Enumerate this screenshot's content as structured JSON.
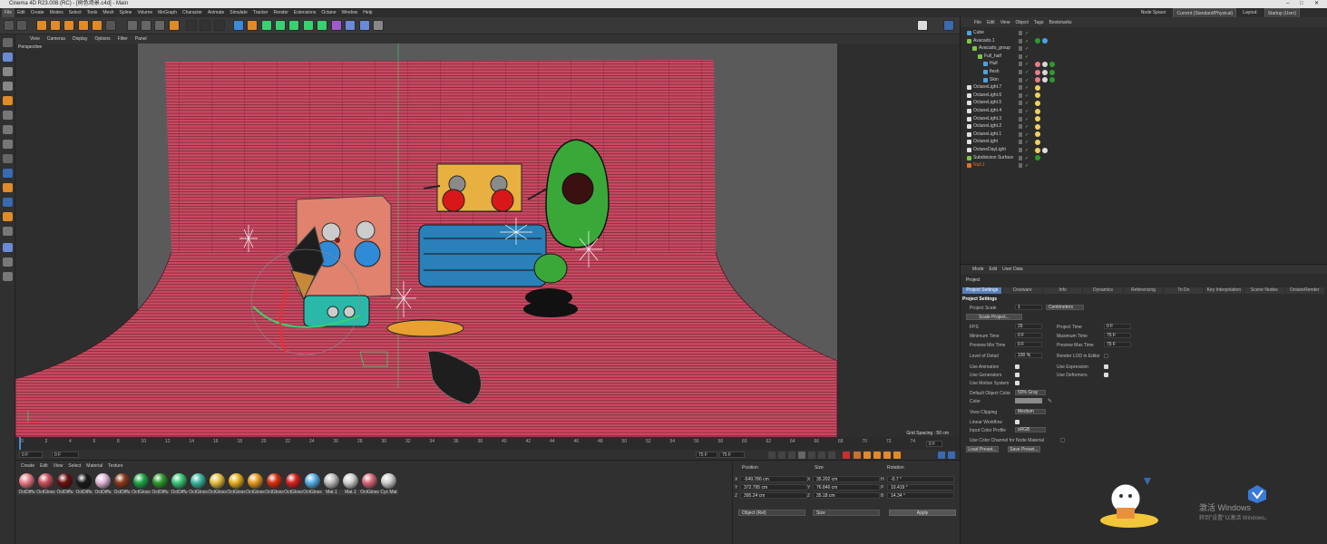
{
  "window": {
    "title": "Cinema 4D R23.008 (RC) - [树色场景.c4d] - Main"
  },
  "menubar": {
    "items": [
      "File",
      "Edit",
      "Create",
      "Modes",
      "Select",
      "Tools",
      "Mesh",
      "Spline",
      "Volume",
      "MoGraph",
      "Character",
      "Animate",
      "Simulate",
      "Tracker",
      "Render",
      "Extensions",
      "Octane",
      "Window",
      "Help"
    ],
    "node_space_label": "Node Space:",
    "node_space_value": "Current (Standard/Physical)",
    "layout_label": "Layout:",
    "layout_value": "Startup (User)"
  },
  "viewport": {
    "menu": [
      "View",
      "Cameras",
      "Display",
      "Options",
      "Filter",
      "Panel"
    ],
    "camera": "Perspective",
    "grid_spacing": "Grid Spacing : 50 cm"
  },
  "timeline": {
    "ticks": [
      "0",
      "2",
      "4",
      "6",
      "8",
      "10",
      "12",
      "14",
      "16",
      "18",
      "20",
      "22",
      "24",
      "26",
      "28",
      "30",
      "32",
      "34",
      "36",
      "38",
      "40",
      "42",
      "44",
      "46",
      "48",
      "50",
      "52",
      "54",
      "56",
      "58",
      "60",
      "62",
      "64",
      "66",
      "68",
      "70",
      "72",
      "74"
    ],
    "current_frame": "0 F"
  },
  "transport": {
    "start": "0 F",
    "current": "0 F",
    "end": "75 F",
    "end2": "75 F"
  },
  "materials": {
    "menu": [
      "Create",
      "Edit",
      "View",
      "Select",
      "Material",
      "Texture"
    ],
    "items": [
      {
        "label": "OctDiffu",
        "color": "#e87c86"
      },
      {
        "label": "OctGloss",
        "color": "#c8505c"
      },
      {
        "label": "OctDiffu",
        "color": "#6a1010"
      },
      {
        "label": "OctDiffu",
        "color": "#1a1a1a"
      },
      {
        "label": "OctDiffu",
        "color": "#e0b8d8"
      },
      {
        "label": "OctDiffu",
        "color": "#8a3a1a"
      },
      {
        "label": "OctGloss",
        "color": "#1ea84a"
      },
      {
        "label": "OctDiffu",
        "color": "#2e9a2e"
      },
      {
        "label": "OctDiffu",
        "color": "#3cc87a"
      },
      {
        "label": "OctGloss",
        "color": "#3ab8a0"
      },
      {
        "label": "OctGloss",
        "color": "#e8c040"
      },
      {
        "label": "OctGloss",
        "color": "#e8b020"
      },
      {
        "label": "OctGloss",
        "color": "#e89a20"
      },
      {
        "label": "OctGloss",
        "color": "#d83010"
      },
      {
        "label": "OctGloss",
        "color": "#d82020"
      },
      {
        "label": "OctGloss",
        "color": "#58b0e8"
      },
      {
        "label": "Mat.1",
        "color": "#bdbdbd"
      },
      {
        "label": "Mat.1",
        "color": "#d0d0d0"
      },
      {
        "label": "OctGloss",
        "color": "#d86878"
      },
      {
        "label": "Cyc Mat",
        "color": "#cfcfcf"
      }
    ]
  },
  "coords": {
    "headers": [
      "Position",
      "Size",
      "Rotation"
    ],
    "rows": [
      {
        "axis": "X",
        "pos": "-549.786 cm",
        "saxis": "X",
        "size": "35.202 cm",
        "raxis": "H",
        "rot": "-0.7 °"
      },
      {
        "axis": "Y",
        "pos": "372.795 cm",
        "saxis": "Y",
        "size": "76.846 cm",
        "raxis": "P",
        "rot": "10.419 °"
      },
      {
        "axis": "Z",
        "pos": "395.24 cm",
        "saxis": "Z",
        "size": "35.18 cm",
        "raxis": "B",
        "rot": "14.34 °"
      }
    ],
    "mode": "Object (Rel)",
    "size_mode": "Size",
    "apply": "Apply"
  },
  "objects": {
    "menu": [
      "File",
      "Edit",
      "View",
      "Object",
      "Tags",
      "Bookmarks"
    ],
    "rows": [
      {
        "name": "Cube",
        "indent": 0,
        "icon": "#4aa3df",
        "tags": []
      },
      {
        "name": "Avacado.1",
        "indent": 0,
        "icon": "#7ac943",
        "tags": [
          "#2e9a2e",
          "#4aa3df"
        ]
      },
      {
        "name": "Avacado_group",
        "indent": 1,
        "icon": "#7ac943",
        "tags": []
      },
      {
        "name": "Full_half",
        "indent": 2,
        "icon": "#7ac943",
        "tags": []
      },
      {
        "name": "Hull",
        "indent": 3,
        "icon": "#4aa3df",
        "tags": [
          "#e87c86",
          "#d8d8d8",
          "#2e9a2e"
        ]
      },
      {
        "name": "flesh",
        "indent": 3,
        "icon": "#4aa3df",
        "tags": [
          "#e87c86",
          "#d8d8d8",
          "#2e9a2e"
        ]
      },
      {
        "name": "Skin",
        "indent": 3,
        "icon": "#4aa3df",
        "tags": [
          "#e87c86",
          "#d8d8d8",
          "#2e9a2e"
        ]
      },
      {
        "name": "OctaneLight.7",
        "indent": 0,
        "icon": "#e0e0e0",
        "tags": [
          "#f0d060"
        ]
      },
      {
        "name": "OctaneLight.6",
        "indent": 0,
        "icon": "#e0e0e0",
        "tags": [
          "#f0d060"
        ]
      },
      {
        "name": "OctaneLight.5",
        "indent": 0,
        "icon": "#e0e0e0",
        "tags": [
          "#f0d060"
        ]
      },
      {
        "name": "OctaneLight.4",
        "indent": 0,
        "icon": "#e0e0e0",
        "tags": [
          "#f0d060"
        ]
      },
      {
        "name": "OctaneLight.3",
        "indent": 0,
        "icon": "#e0e0e0",
        "tags": [
          "#f0d060"
        ]
      },
      {
        "name": "OctaneLight.2",
        "indent": 0,
        "icon": "#e0e0e0",
        "tags": [
          "#f0d060"
        ]
      },
      {
        "name": "OctaneLight.1",
        "indent": 0,
        "icon": "#e0e0e0",
        "tags": [
          "#f0d060"
        ]
      },
      {
        "name": "OctaneLight",
        "indent": 0,
        "icon": "#e0e0e0",
        "tags": [
          "#f0d060"
        ]
      },
      {
        "name": "OctaneDayLight",
        "indent": 0,
        "icon": "#e0e0e0",
        "tags": [
          "#f0d060",
          "#e0e0e0"
        ]
      },
      {
        "name": "Subdivision Surface",
        "indent": 0,
        "icon": "#7ac943",
        "tags": [
          "#2e9a2e"
        ]
      },
      {
        "name": "Null.1",
        "indent": 0,
        "icon": "#e07030",
        "tags": [],
        "color": "#e07030"
      }
    ]
  },
  "attributes": {
    "menu": [
      "Mode",
      "Edit",
      "User Data"
    ],
    "object": "Project",
    "tabs": [
      "Project Settings",
      "Cineware",
      "Info",
      "Dynamics",
      "Referencing",
      "To Do",
      "Key Interpolation",
      "Scene Nodes",
      "OctaneRender"
    ],
    "section": "Project Settings",
    "project_scale_label": "Project Scale",
    "project_scale_value": "1",
    "project_scale_unit": "Centimeters",
    "scale_button": "Scale Project...",
    "fps_label": "FPS",
    "fps": "25",
    "project_time_label": "Project Time",
    "project_time": "0 F",
    "min_time_label": "Minimum Time",
    "min_time": "0 F",
    "max_time_label": "Maximum Time",
    "max_time": "75 F",
    "prev_min_label": "Preview Min Time",
    "prev_min": "0 F",
    "prev_max_label": "Preview Max Time",
    "prev_max": "75 F",
    "lod_label": "Level of Detail",
    "lod": "100 %",
    "render_lod_label": "Render LOD in Editor",
    "use_animation": "Use Animation",
    "use_expression": "Use Expression",
    "use_generators": "Use Generators",
    "use_deformers": "Use Deformers",
    "use_motion": "Use Motion System",
    "default_color_label": "Default Object Color",
    "default_color": "50% Gray",
    "color_label": "Color",
    "view_clipping_label": "View Clipping",
    "view_clipping": "Medium",
    "linear_label": "Linear Workflow",
    "input_profile_label": "Input Color Profile",
    "input_profile": "sRGB",
    "color_channel_label": "Use Color Channel for Node Material",
    "load_preset": "Load Preset...",
    "save_preset": "Save Preset..."
  },
  "watermark": {
    "line1": "激活 Windows",
    "line2": "转到\"设置\"以激活 Windows。"
  },
  "colors": {
    "backdrop": "#c84a62",
    "accent": "#5a7fb8"
  }
}
